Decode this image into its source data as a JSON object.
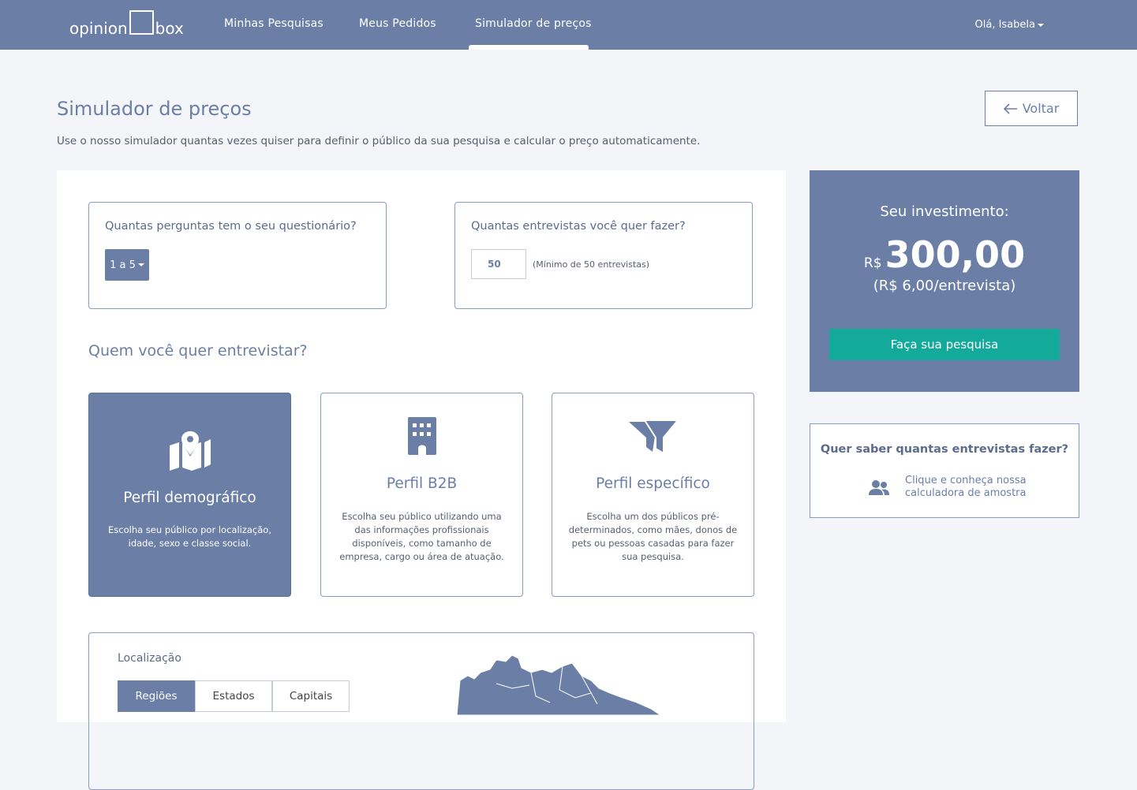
{
  "header": {
    "logo_left": "opinion",
    "logo_right": "box",
    "nav": [
      {
        "label": "Minhas Pesquisas"
      },
      {
        "label": "Meus Pedidos"
      },
      {
        "label": "Simulador de preços"
      }
    ],
    "user": "Olá, Isabela"
  },
  "page": {
    "title": "Simulador de preços",
    "subtitle": "Use o nosso simulador quantas vezes quiser para definir o público da sua pesquisa e calcular o preço automaticamente.",
    "back_label": "Voltar"
  },
  "questions": {
    "label": "Quantas perguntas tem o seu questionário?",
    "selected": "1 a 5"
  },
  "interviews": {
    "label": "Quantas entrevistas você quer fazer?",
    "value": "50",
    "hint": "(Mínimo de 50 entrevistas)"
  },
  "who": {
    "title": "Quem você quer entrevistar?",
    "profiles": [
      {
        "title": "Perfil demográfico",
        "desc": "Escolha seu público por localização, idade, sexo e classe social.",
        "icon": "map-pin-icon"
      },
      {
        "title": "Perfil B2B",
        "desc": "Escolha seu público utilizando uma das informações profissionais disponíveis, como tamanho de empresa, cargo ou área de atuação.",
        "icon": "building-icon"
      },
      {
        "title": "Perfil específico",
        "desc": "Escolha um dos públicos pré-determinados, como mães, donos de pets ou pessoas casadas para fazer sua pesquisa.",
        "icon": "filter-icon"
      }
    ]
  },
  "location": {
    "label": "Localização",
    "tabs": [
      {
        "label": "Regiões"
      },
      {
        "label": "Estados"
      },
      {
        "label": "Capitais"
      }
    ]
  },
  "investment": {
    "title": "Seu investimento:",
    "currency": "R$",
    "amount": "300,00",
    "per": "(R$ 6,00/entrevista)",
    "cta": "Faça sua pesquisa"
  },
  "calculator": {
    "title": "Quer saber quantas entrevistas fazer?",
    "link": "Clique e conheça nossa calculadora de amostra"
  },
  "colors": {
    "primary": "#6b7fa6",
    "accent": "#13a99b",
    "background": "#f4f5f8"
  }
}
